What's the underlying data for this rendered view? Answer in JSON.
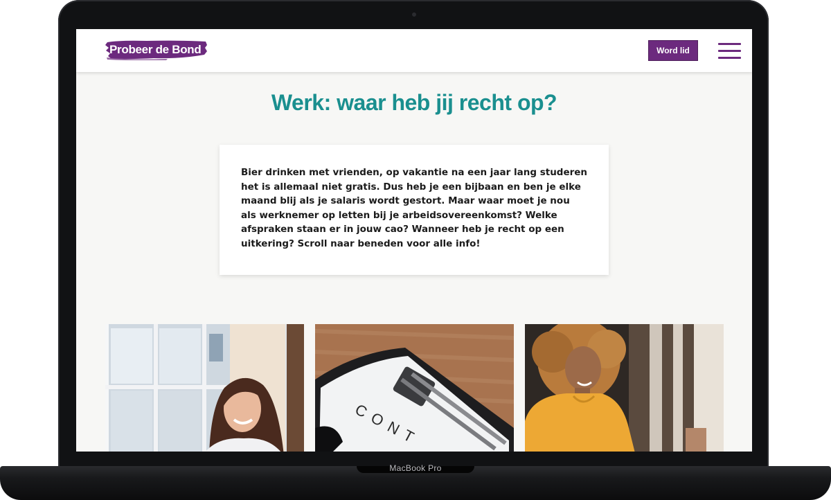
{
  "device": {
    "label": "MacBook Pro"
  },
  "header": {
    "logo_text": "Probeer de Bond",
    "cta_label": "Word lid",
    "menu_icon": "hamburger-icon"
  },
  "page": {
    "title": "Werk: waar heb jij recht op?",
    "intro": "Bier drinken met vrienden, op vakantie na een jaar lang studeren het is allemaal niet gratis. Dus heb je een bijbaan en ben je elke maand blij als je salaris wordt gestort. Maar waar moet je nou als werknemer op letten bij je arbeidsovereenkomst? Welke afspraken staan er in jouw cao? Wanneer heb je recht op een uitkering? Scroll naar beneden voor alle info!"
  },
  "cards": [
    {
      "image": "smiling-woman-window-photo"
    },
    {
      "image": "contract-clipboard-photo",
      "visible_text": "CONT"
    },
    {
      "image": "woman-curly-hair-yellow-sweater-photo"
    }
  ],
  "colors": {
    "brand_purple": "#6c2a7e",
    "title_teal": "#1a8f8f",
    "page_background": "#f7f7f5"
  }
}
